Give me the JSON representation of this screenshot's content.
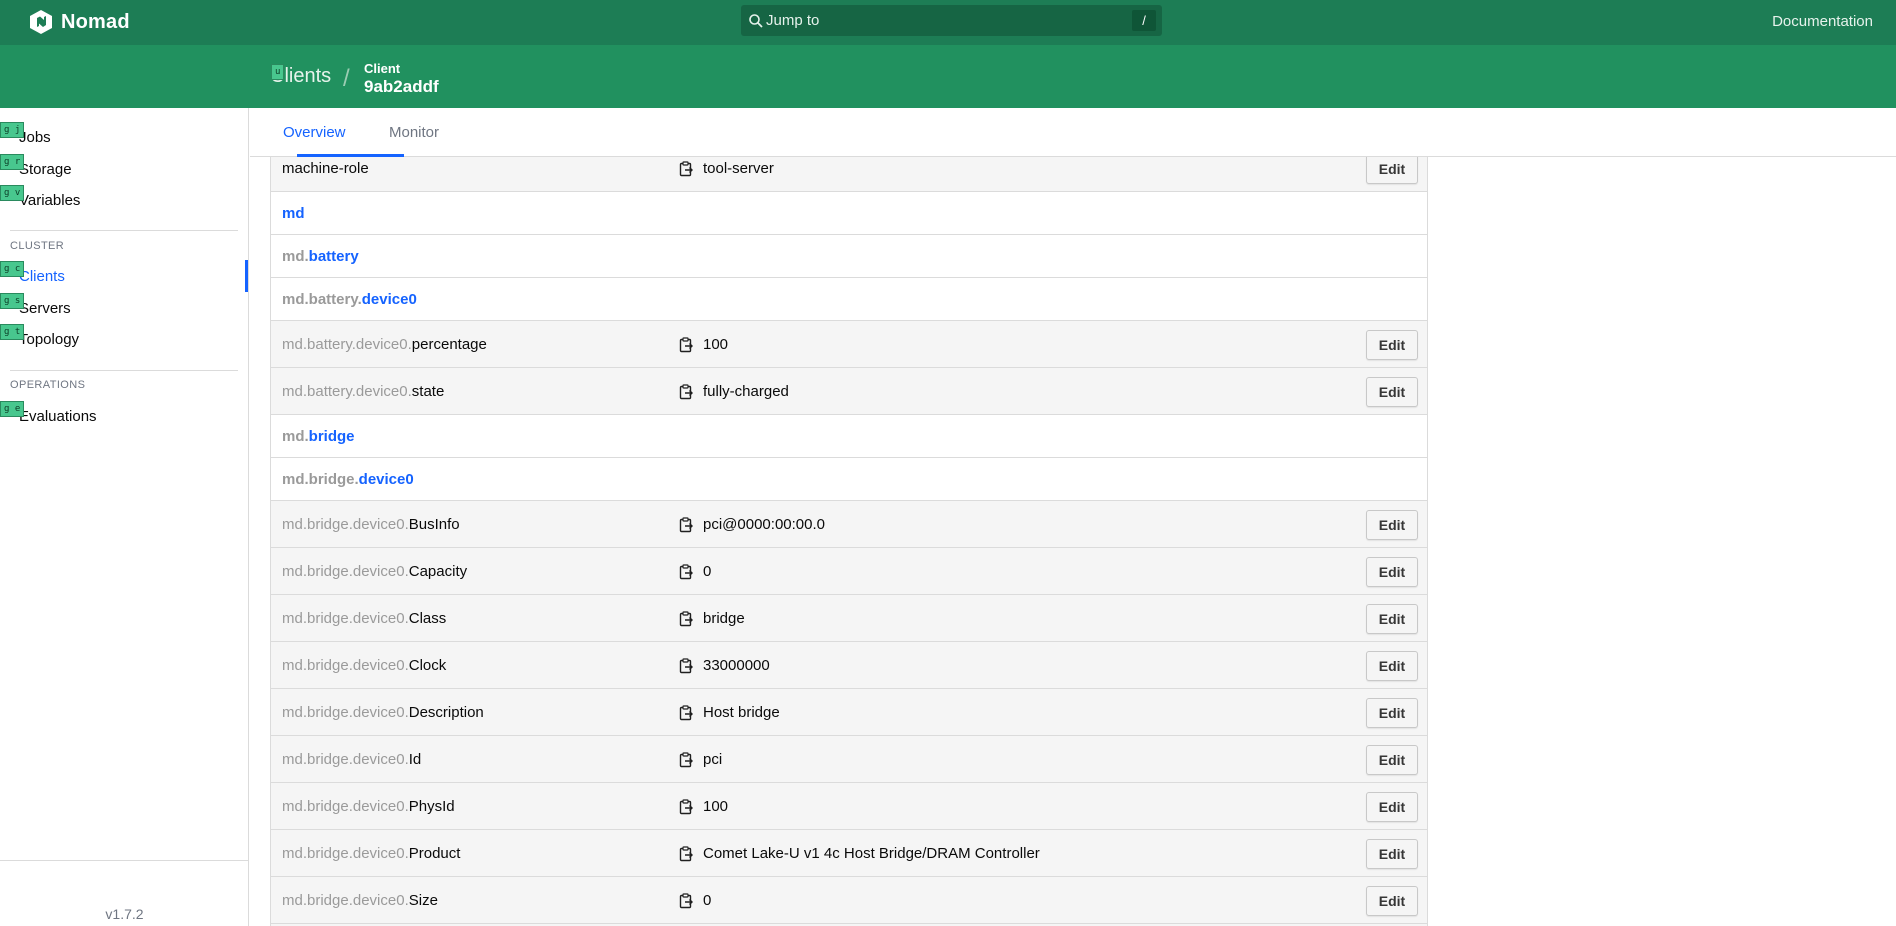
{
  "app": {
    "name": "Nomad"
  },
  "search": {
    "placeholder": "Jump to",
    "shortcut": "/"
  },
  "header": {
    "docs_label": "Documentation"
  },
  "breadcrumb": {
    "parent": "Clients",
    "label": "Client",
    "id": "9ab2addf"
  },
  "hints": {
    "up": "u",
    "jobs": "g j",
    "storage": "g r",
    "variables": "g v",
    "clients": "g c",
    "servers": "g s",
    "topology": "g t",
    "evaluations": "g e"
  },
  "sidebar": {
    "items": [
      {
        "label": "Jobs"
      },
      {
        "label": "Storage"
      },
      {
        "label": "Variables"
      }
    ],
    "cluster_heading": "CLUSTER",
    "cluster_items": [
      {
        "label": "Clients"
      },
      {
        "label": "Servers"
      },
      {
        "label": "Topology"
      }
    ],
    "operations_heading": "OPERATIONS",
    "operations_items": [
      {
        "label": "Evaluations"
      }
    ],
    "version": "v1.7.2"
  },
  "tabs": [
    {
      "label": "Overview"
    },
    {
      "label": "Monitor"
    }
  ],
  "metadata": {
    "edit_label": "Edit",
    "rows": [
      {
        "type": "attr",
        "prefix": "",
        "leaf": "machine-role",
        "value": "tool-server"
      },
      {
        "type": "group",
        "prefix": "",
        "leaf": "md"
      },
      {
        "type": "group",
        "prefix": "md.",
        "leaf": "battery"
      },
      {
        "type": "group",
        "prefix": "md.battery.",
        "leaf": "device0"
      },
      {
        "type": "attr",
        "prefix": "md.battery.device0.",
        "leaf": "percentage",
        "value": "100"
      },
      {
        "type": "attr",
        "prefix": "md.battery.device0.",
        "leaf": "state",
        "value": "fully-charged"
      },
      {
        "type": "group",
        "prefix": "md.",
        "leaf": "bridge"
      },
      {
        "type": "group",
        "prefix": "md.bridge.",
        "leaf": "device0"
      },
      {
        "type": "attr",
        "prefix": "md.bridge.device0.",
        "leaf": "BusInfo",
        "value": "pci@0000:00:00.0"
      },
      {
        "type": "attr",
        "prefix": "md.bridge.device0.",
        "leaf": "Capacity",
        "value": "0"
      },
      {
        "type": "attr",
        "prefix": "md.bridge.device0.",
        "leaf": "Class",
        "value": "bridge"
      },
      {
        "type": "attr",
        "prefix": "md.bridge.device0.",
        "leaf": "Clock",
        "value": "33000000"
      },
      {
        "type": "attr",
        "prefix": "md.bridge.device0.",
        "leaf": "Description",
        "value": "Host bridge"
      },
      {
        "type": "attr",
        "prefix": "md.bridge.device0.",
        "leaf": "Id",
        "value": "pci"
      },
      {
        "type": "attr",
        "prefix": "md.bridge.device0.",
        "leaf": "PhysId",
        "value": "100"
      },
      {
        "type": "attr",
        "prefix": "md.bridge.device0.",
        "leaf": "Product",
        "value": "Comet Lake-U v1 4c Host Bridge/DRAM Controller"
      },
      {
        "type": "attr",
        "prefix": "md.bridge.device0.",
        "leaf": "Size",
        "value": "0"
      },
      {
        "type": "attr",
        "prefix": "",
        "leaf": "",
        "value": ""
      }
    ]
  }
}
